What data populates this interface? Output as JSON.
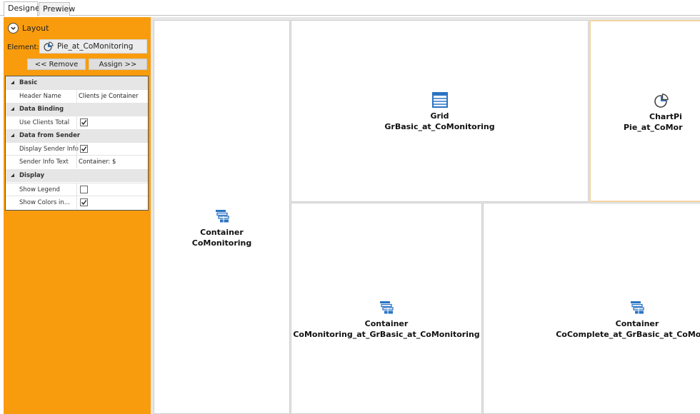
{
  "tabs": [
    {
      "label": "Designer",
      "active": true
    },
    {
      "label": "Prewiew",
      "active": false
    }
  ],
  "layout": {
    "header_label": "Layout",
    "element_label": "Element:",
    "element_value": "Pie_at_CoMonitoring",
    "remove_label": "<< Remove",
    "assign_label": "Assign >>"
  },
  "properties": {
    "categories": [
      {
        "name": "Basic",
        "items": [
          {
            "name": "Header Name",
            "type": "text",
            "value": "Clients je Container"
          }
        ]
      },
      {
        "name": "Data Binding",
        "items": [
          {
            "name": "Use Clients Total",
            "type": "checkbox",
            "checked": true
          }
        ]
      },
      {
        "name": "Data from Sender",
        "items": [
          {
            "name": "Display Sender Info",
            "type": "checkbox",
            "checked": true
          },
          {
            "name": "Sender Info Text",
            "type": "text",
            "value": "Container: $"
          }
        ]
      },
      {
        "name": "Display",
        "items": [
          {
            "name": "Show Legend",
            "type": "checkbox",
            "checked": false
          },
          {
            "name": "Show Colors in...",
            "type": "checkbox",
            "checked": true
          }
        ]
      }
    ]
  },
  "panes": {
    "container_main": {
      "title": "Container",
      "name": "CoMonitoring",
      "icon": "container-icon"
    },
    "grid": {
      "title": "Grid",
      "name": "GrBasic_at_CoMonitoring",
      "icon": "grid-icon"
    },
    "chart": {
      "title": "ChartPi",
      "name": "Pie_at_CoMor",
      "icon": "pie-chart-icon"
    },
    "container_mid": {
      "title": "Container",
      "name": "CoMonitoring_at_GrBasic_at_CoMonitoring",
      "icon": "container-icon"
    },
    "container_right": {
      "title": "Container",
      "name": "CoComplete_at_GrBasic_at_CoMonito",
      "icon": "container-icon"
    }
  },
  "colors": {
    "panel_orange": "#f89c0e",
    "icon_blue": "#2b74c4",
    "selection_border": "#f3d6a4"
  }
}
